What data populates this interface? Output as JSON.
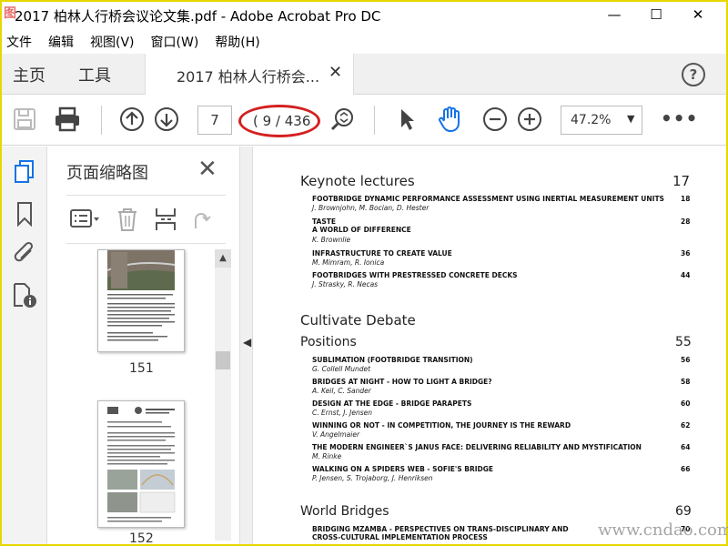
{
  "window": {
    "title": "2017 柏林人行桥会议论文集.pdf - Adobe Acrobat Pro DC",
    "watermark_logo": "图",
    "minimize": "—",
    "maximize": "☐",
    "close": "✕"
  },
  "menu": [
    "文件",
    "编辑",
    "视图(V)",
    "窗口(W)",
    "帮助(H)"
  ],
  "tabs": {
    "home": "主页",
    "tools": "工具",
    "document": "2017 柏林人行桥会...",
    "close": "✕",
    "help": "?"
  },
  "toolbar": {
    "page_current": "7",
    "page_total": "( 9 / 436 )",
    "zoom": "47.2%",
    "zoom_caret": "▼",
    "more": "•••"
  },
  "thumbnails_panel": {
    "title": "页面缩略图",
    "close": "✕",
    "scroll_up": "▲",
    "pages": [
      {
        "number": "151"
      },
      {
        "number": "152"
      }
    ]
  },
  "document": {
    "sections": [
      {
        "title": "Keynote lectures",
        "page": "17",
        "entries": [
          {
            "title": "FOOTBRIDGE DYNAMIC PERFORMANCE ASSESSMENT USING INERTIAL MEASUREMENT UNITS",
            "authors": "J. Brownjohn, M. Bocian, D. Hester",
            "page": "18"
          },
          {
            "title": "TASTE",
            "title2": "A WORLD OF DIFFERENCE",
            "authors": "K. Brownlie",
            "page": "28"
          },
          {
            "title": "INFRASTRUCTURE TO CREATE VALUE",
            "authors": "M. Mimram, R. Ionica",
            "page": "36"
          },
          {
            "title": "FOOTBRIDGES WITH PRESTRESSED CONCRETE DECKS",
            "authors": "J. Strasky, R. Necas",
            "page": "44"
          }
        ]
      },
      {
        "title": "Cultivate Debate",
        "page": "",
        "subtitle": "Positions",
        "subpage": "55",
        "entries": [
          {
            "title": "SUBLIMATION (FOOTBRIDGE TRANSITION)",
            "authors": "G. Collell Mundet",
            "page": "56"
          },
          {
            "title": "BRIDGES AT NIGHT - HOW TO LIGHT A BRIDGE?",
            "authors": "A. Keil, C. Sander",
            "page": "58"
          },
          {
            "title": "DESIGN AT THE EDGE - BRIDGE PARAPETS",
            "authors": "C. Ernst, J. Jensen",
            "page": "60"
          },
          {
            "title": "WINNING OR NOT - IN COMPETITION, THE JOURNEY IS THE REWARD",
            "authors": "V. Angelmaier",
            "page": "62"
          },
          {
            "title": "THE MODERN ENGINEER`S JANUS FACE: DELIVERING RELIABILITY AND MYSTIFICATION",
            "authors": "M. Rinke",
            "page": "64"
          },
          {
            "title": "WALKING ON A SPIDERS WEB - SOFIE'S BRIDGE",
            "authors": "P. Jensen, S. Trojaborg, J. Henriksen",
            "page": "66"
          }
        ]
      },
      {
        "title": "World Bridges",
        "page": "69",
        "entries": [
          {
            "title": "BRIDGING MZAMBA - PERSPECTIVES ON TRANS-DISCIPLINARY AND",
            "title2": "CROSS-CULTURAL IMPLEMENTATION PROCESS",
            "page": "70"
          }
        ]
      }
    ]
  },
  "site_watermark": "www.cndao.com"
}
